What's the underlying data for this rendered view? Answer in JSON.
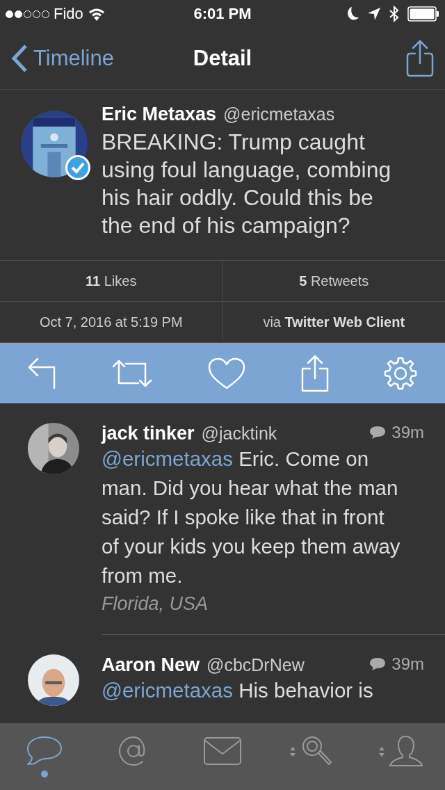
{
  "status_bar": {
    "carrier": "Fido",
    "time": "6:01 PM"
  },
  "nav": {
    "back": "Timeline",
    "title": "Detail"
  },
  "tweet": {
    "name": "Eric Metaxas",
    "handle": "@ericmetaxas",
    "verified": true,
    "text": "BREAKING: Trump caught using foul language, combing his hair oddly. Could this be the end of his campaign?",
    "stats": [
      {
        "count": "11",
        "label": "Likes"
      },
      {
        "count": "5",
        "label": "Retweets"
      }
    ],
    "date": "Oct 7, 2016 at 5:19 PM",
    "via": "via",
    "client": "Twitter Web Client"
  },
  "actions": [
    {
      "kind": "reply"
    },
    {
      "kind": "retweet"
    },
    {
      "kind": "like"
    },
    {
      "kind": "share"
    },
    {
      "kind": "settings"
    }
  ],
  "replies": [
    {
      "name": "jack tinker",
      "handle": "@jacktink",
      "time": "39m",
      "mention": "@ericmetaxas",
      "text": "Eric. Come on man. Did you hear what the man said? If I spoke like that in front of your kids you keep them away from me.",
      "location": "Florida, USA"
    },
    {
      "name": "Aaron New",
      "handle": "@cbcDrNew",
      "time": "39m",
      "mention": "@ericmetaxas",
      "text": "His behavior is"
    }
  ],
  "tabs": [
    {
      "kind": "timeline",
      "selected": true
    },
    {
      "kind": "mentions",
      "selected": false
    },
    {
      "kind": "messages",
      "selected": false
    },
    {
      "kind": "search",
      "selected": false
    },
    {
      "kind": "profile",
      "selected": false
    }
  ]
}
